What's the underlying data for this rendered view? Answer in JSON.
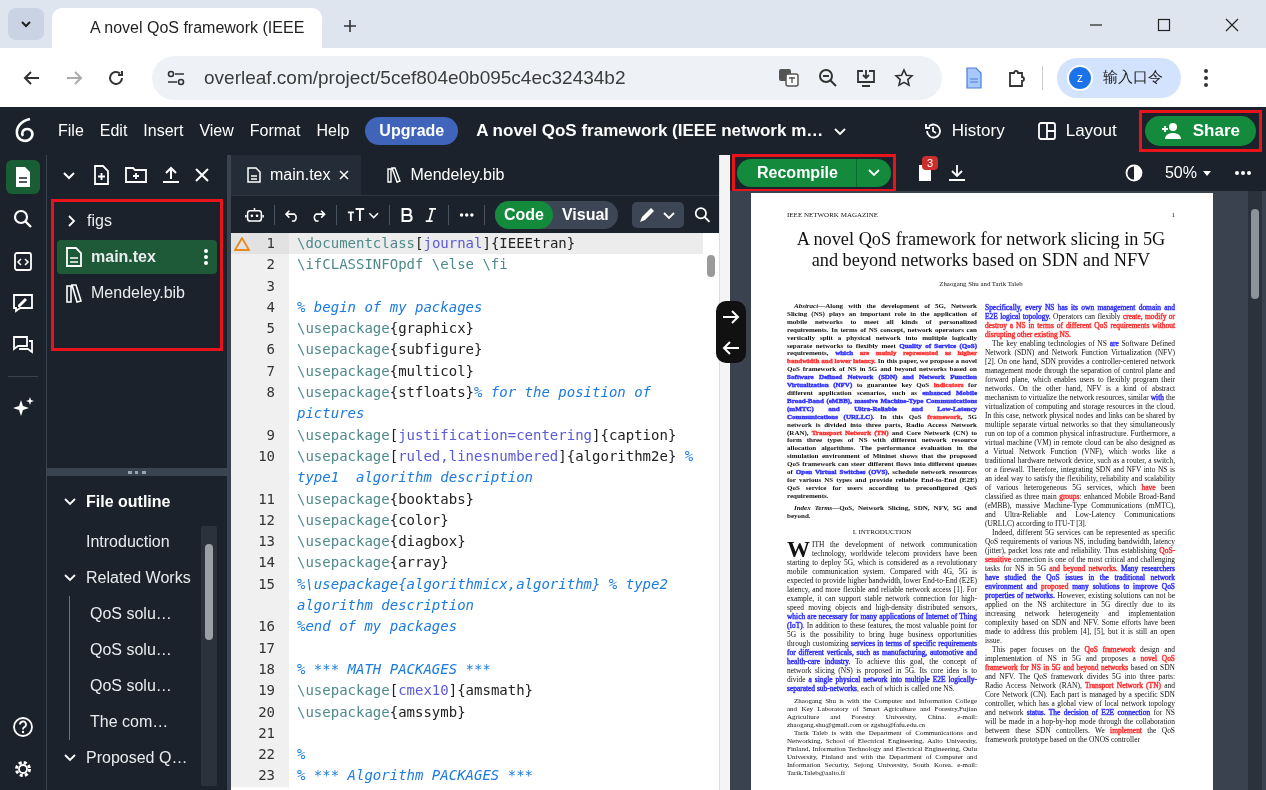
{
  "browser": {
    "tab_title": "A novel QoS framework (IEEE",
    "url": "overleaf.com/project/5cef804e0b095c4ec32434b2",
    "profile_initial": "z",
    "profile_label": "输入口令"
  },
  "menu": [
    "File",
    "Edit",
    "Insert",
    "View",
    "Format",
    "Help"
  ],
  "upgrade": "Upgrade",
  "project_title": "A novel QoS framework (IEEE network m…",
  "history": "History",
  "layout": "Layout",
  "share": "Share",
  "rail": [
    {
      "kind": "files",
      "selected": true
    },
    {
      "kind": "search",
      "selected": false
    },
    {
      "kind": "review",
      "selected": false
    },
    {
      "kind": "preview",
      "selected": false
    },
    {
      "kind": "chat",
      "selected": false
    },
    {
      "kind": "ai",
      "selected": false
    }
  ],
  "file_tree": [
    {
      "name": "figs",
      "kind": "folder",
      "selected": false
    },
    {
      "name": "main.tex",
      "kind": "tex",
      "selected": true
    },
    {
      "name": "Mendeley.bib",
      "kind": "bib",
      "selected": false
    }
  ],
  "outline": {
    "title": "File outline",
    "expanded": true,
    "items": [
      {
        "label": "Introduction"
      },
      {
        "label": "Related Works",
        "expanded": true,
        "children": [
          {
            "label": "QoS solu…"
          },
          {
            "label": "QoS solu…"
          },
          {
            "label": "QoS solu…"
          },
          {
            "label": "The com…"
          }
        ]
      },
      {
        "label": "Proposed Q…",
        "expanded": true
      }
    ]
  },
  "editor_tabs": [
    {
      "label": "main.tex",
      "kind": "tex",
      "selected": true
    },
    {
      "label": "Mendeley.bib",
      "kind": "bib",
      "selected": false
    }
  ],
  "modes": [
    {
      "label": "Code",
      "selected": true
    },
    {
      "label": "Visual",
      "selected": false
    }
  ],
  "code_lines": [
    {
      "n": "1",
      "warning": true,
      "active": true,
      "segs": [
        {
          "kind": "command",
          "t": "\\documentclass"
        },
        {
          "kind": "text",
          "t": "["
        },
        {
          "kind": "option",
          "t": "journal"
        },
        {
          "kind": "text",
          "t": "]{IEEEtran}"
        }
      ]
    },
    {
      "n": "2",
      "warning": false,
      "active": false,
      "segs": [
        {
          "kind": "command",
          "t": "\\ifCLASSINFOpdf \\else \\fi"
        }
      ]
    },
    {
      "n": "3",
      "warning": false,
      "active": false
    },
    {
      "n": "4",
      "warning": false,
      "active": false,
      "segs": [
        {
          "kind": "comment",
          "t": "% begin of my packages"
        }
      ]
    },
    {
      "n": "5",
      "warning": false,
      "active": false,
      "segs": [
        {
          "kind": "command",
          "t": "\\usepackage"
        },
        {
          "kind": "text",
          "t": "{graphicx}"
        }
      ]
    },
    {
      "n": "6",
      "warning": false,
      "active": false,
      "segs": [
        {
          "kind": "command",
          "t": "\\usepackage"
        },
        {
          "kind": "text",
          "t": "{subfigure}"
        }
      ]
    },
    {
      "n": "7",
      "warning": false,
      "active": false,
      "segs": [
        {
          "kind": "command",
          "t": "\\usepackage"
        },
        {
          "kind": "text",
          "t": "{multicol}"
        }
      ]
    },
    {
      "n": "8",
      "warning": false,
      "active": false,
      "segs": [
        {
          "kind": "command",
          "t": "\\usepackage"
        },
        {
          "kind": "text",
          "t": "{stfloats}"
        },
        {
          "kind": "comment",
          "t": "% for the position of pictures"
        }
      ]
    },
    {
      "n": "9",
      "warning": false,
      "active": false,
      "segs": [
        {
          "kind": "command",
          "t": "\\usepackage"
        },
        {
          "kind": "text",
          "t": "["
        },
        {
          "kind": "option",
          "t": "justification=centering"
        },
        {
          "kind": "text",
          "t": "]{caption}"
        }
      ]
    },
    {
      "n": "10",
      "warning": false,
      "active": false,
      "segs": [
        {
          "kind": "command",
          "t": "\\usepackage"
        },
        {
          "kind": "text",
          "t": "["
        },
        {
          "kind": "option",
          "t": "ruled,linesnumbered"
        },
        {
          "kind": "text",
          "t": "]{algorithm2e} "
        },
        {
          "kind": "comment",
          "t": "% type1  algorithm description"
        }
      ]
    },
    {
      "n": "11",
      "warning": false,
      "active": false,
      "segs": [
        {
          "kind": "command",
          "t": "\\usepackage"
        },
        {
          "kind": "text",
          "t": "{booktabs}"
        }
      ]
    },
    {
      "n": "12",
      "warning": false,
      "active": false,
      "segs": [
        {
          "kind": "command",
          "t": "\\usepackage"
        },
        {
          "kind": "text",
          "t": "{color}"
        }
      ]
    },
    {
      "n": "13",
      "warning": false,
      "active": false,
      "segs": [
        {
          "kind": "command",
          "t": "\\usepackage"
        },
        {
          "kind": "text",
          "t": "{diagbox}"
        }
      ]
    },
    {
      "n": "14",
      "warning": false,
      "active": false,
      "segs": [
        {
          "kind": "command",
          "t": "\\usepackage"
        },
        {
          "kind": "text",
          "t": "{array}"
        }
      ]
    },
    {
      "n": "15",
      "warning": false,
      "active": false,
      "segs": [
        {
          "kind": "comment",
          "t": "%\\usepackage{algorithmicx,algorithm} % type2 algorithm description"
        }
      ]
    },
    {
      "n": "16",
      "warning": false,
      "active": false,
      "segs": [
        {
          "kind": "comment",
          "t": "%end of my packages"
        }
      ]
    },
    {
      "n": "17",
      "warning": false,
      "active": false
    },
    {
      "n": "18",
      "warning": false,
      "active": false,
      "segs": [
        {
          "kind": "comment",
          "t": "% *** MATH PACKAGES ***"
        }
      ]
    },
    {
      "n": "19",
      "warning": false,
      "active": false,
      "segs": [
        {
          "kind": "command",
          "t": "\\usepackage"
        },
        {
          "kind": "text",
          "t": "["
        },
        {
          "kind": "option",
          "t": "cmex10"
        },
        {
          "kind": "text",
          "t": "]{amsmath}"
        }
      ]
    },
    {
      "n": "20",
      "warning": false,
      "active": false,
      "segs": [
        {
          "kind": "command",
          "t": "\\usepackage"
        },
        {
          "kind": "text",
          "t": "{amssymb}"
        }
      ]
    },
    {
      "n": "21",
      "warning": false,
      "active": false
    },
    {
      "n": "22",
      "warning": false,
      "active": false,
      "segs": [
        {
          "kind": "comment",
          "t": "%"
        }
      ]
    },
    {
      "n": "23",
      "warning": false,
      "active": false,
      "segs": [
        {
          "kind": "comment",
          "t": "% *** Algorithm PACKAGES ***"
        }
      ]
    }
  ],
  "pdf": {
    "recompile": "Recompile",
    "error_count": "3",
    "zoom": "50%",
    "header": "IEEE NETWORK MAGAZINE",
    "page_number": "1",
    "title": "A novel QoS framework for network slicing in 5G and beyond networks based on SDN and NFV",
    "authors": "Zhaogang Shu and Tarik Taleb",
    "left": [
      {
        "kind": "abstract",
        "segs": [
          {
            "t": "Abstract",
            "italic": true
          },
          {
            "t": "—Along with the development of 5G, Network Slicing (NS) plays an important role in the application of mobile networks to meet all kinds of personalized requirements. In terms of NS concept, network operators can vertically split a physical network into multiple logically separate networks to flexibly meet "
          },
          {
            "t": "Quality of Service (QoS)",
            "color": "#3333ff"
          },
          {
            "t": " requirements, "
          },
          {
            "t": "which",
            "color": "#3333ff"
          },
          {
            "t": " are mainly represented as higher bandwidth and lower latency.",
            "color": "#ff3333"
          },
          {
            "t": " In this paper, we propose a novel QoS framework of NS in 5G and beyond networks based on "
          },
          {
            "t": "Software Defined Network (SDN) and Network Function Virtualization (NFV)",
            "color": "#3333ff"
          },
          {
            "t": " to guarantee key QoS "
          },
          {
            "t": "indicators",
            "color": "#ff3333"
          },
          {
            "t": " for different application scenarios, such as "
          },
          {
            "t": "enhanced Mobile Broad-Band (eMBB), massive Machine-Type Communications (mMTC) and Ultra-Reliable and Low-Latency Communications (URLLC)",
            "color": "#3333ff"
          },
          {
            "t": ". In this QoS "
          },
          {
            "t": "framework",
            "color": "#ff3333"
          },
          {
            "t": ", 5G network is divided into three parts, Radio Access Network (RAN), "
          },
          {
            "t": "Transport Network (TN)",
            "color": "#ff3333"
          },
          {
            "t": " and Core Network (CN) to form three types of NS with different network resource allocation algorithms. The performance evaluation in the simulation environment of Mininet shows that the proposed QoS framework can steer different flows into different queues of "
          },
          {
            "t": "Open Virtual Switches (OVS)",
            "color": "#3333ff"
          },
          {
            "t": ", schedule network resources for various NS types and provide reliable End-to-End (E2E) QoS service for users according to preconfigured QoS requirements."
          }
        ]
      },
      {
        "kind": "abstract",
        "segs": [
          {
            "t": "Index Terms",
            "italic": true
          },
          {
            "t": "—QoS, Network Slicing, SDN, NFV, 5G and beyond."
          }
        ]
      },
      {
        "kind": "heading",
        "segs": [
          {
            "t": "I. INTRODUCTION"
          }
        ]
      },
      {
        "kind": "dropcap",
        "segs": [
          {
            "t": "W",
            "dropcap": true
          },
          {
            "t": "ITH the development of network communication technology, worldwide telecom providers have been starting to deploy 5G, which is considered as a revolutionary mobile communication system. Compared with 4G, 5G is expected to provide higher bandwidth, lower End-to-End (E2E) latency, and more flexible and reliable network access [1]. For example, it can support stable network connection for high-speed moving objects and high-density distributed sensors, "
          },
          {
            "t": "which are necessary for many applications of Internet of Thing (IoT)",
            "color": "#3333ff"
          },
          {
            "t": ". In addition to these features, the most valuable point for 5G is the possibility to bring huge business opportunities through customizing "
          },
          {
            "t": "services in terms of specific requirements for different verticals, such as manufacturing, automotive and health-care industry.",
            "color": "#3333ff"
          },
          {
            "t": " To achieve this goal, the concept of network slicing (NS) is proposed in 5G. Its core idea is to divide "
          },
          {
            "t": "a single physical network into multiple E2E logically-separated sub-networks",
            "color": "#3333ff"
          },
          {
            "t": ", each of which is called one NS."
          }
        ]
      },
      {
        "kind": "footnote",
        "segs": [
          {
            "t": "Zhaogang Shu is with the Computer and Information College and Key Laboratory of Smart Agriculture and Forestry,Fujian Agriculture and Forestry University, China. e-mail: zhaogang.shu@gmail.com or zgshu@fafu.edu.cn"
          }
        ]
      },
      {
        "kind": "footnote",
        "segs": [
          {
            "t": "Tarik Taleb is with the Department of Communications and Networking, School of Electrical Engineering, Aalto University, Finland, Information Technology and Electrical Engineering, Oulu University, Finland and with the Department of Computer and Information Security, Sejong University, South Korea. e-mail: Tarik.Taleb@aalto.fi"
          }
        ]
      }
    ],
    "right": [
      {
        "kind": "continued",
        "segs": [
          {
            "t": "Specifically, every NS has its own management domain and E2E logical topology.",
            "color": "#3333ff"
          },
          {
            "t": " Operators can flexibly "
          },
          {
            "t": "create, modify or destroy a NS in terms of different QoS requirements without disrupting other existing NS.",
            "color": "#ff3333"
          }
        ]
      },
      {
        "kind": "body",
        "segs": [
          {
            "t": "The key enabling technologies of NS "
          },
          {
            "t": "are",
            "color": "#3333ff"
          },
          {
            "t": " Software Defined Network (SDN) and Network Function Virtualization (NFV) [2]. On one hand, SDN provides a controller-centered network management mode through the separation of control plane and forward plane, which enables users to flexibly program their networks. On the other hand, NFV is a kind of abstract mechanism to virtualize the network resources, similar "
          },
          {
            "t": "with",
            "color": "#3333ff"
          },
          {
            "t": " the virtualization of computing and storage resources in the cloud. In this case, network physical nodes and links can be shared by multiple separate virtual networks so that they simultaneously run on top of a common physical infrastructure. Furthermore, a virtual machine (VM) in remote cloud can be also designed as a Virtual Network Function (VNF), which works like a traditional hardware network device, such as a router, a switch, or a firewall. Therefore, integrating SDN and NFV into NS is an ideal way to satisfy the flexibility, reliability and scalability of various heterogeneous 5G services, which "
          },
          {
            "t": "have",
            "color": "#ff3333"
          },
          {
            "t": " been classified as three main "
          },
          {
            "t": "groups",
            "color": "#ff3333"
          },
          {
            "t": ": enhanced Mobile Broad-Band (eMBB), massive Machine-Type Communications (mMTC), and Ultra-Reliable and Low-Latency Communications (URLLC) according to ITU-T [3]."
          }
        ]
      },
      {
        "kind": "body",
        "segs": [
          {
            "t": "Indeed, different 5G services can be represented as specific QoS requirements of various NS, including bandwidth, latency (jitter), packet loss rate and reliability. Thus establishing "
          },
          {
            "t": "QoS-sensitive",
            "color": "#ff3333"
          },
          {
            "t": " connection is one of the most critical and challenging tasks for NS in 5G "
          },
          {
            "t": "and beyond networks. ",
            "color": "#ff3333"
          },
          {
            "t": "Many researchers have studied the QoS issues in the traditional network environment and ",
            "color": "#3333ff"
          },
          {
            "t": "proposed",
            "color": "#ff3333"
          },
          {
            "t": " many solutions to improve QoS properties of networks.",
            "color": "#3333ff"
          },
          {
            "t": " However, existing solutions can not be applied on the NS architecture in 5G directly due to its increasing network heterogeneity and implementation complexity based on SDN and NFV. Some efforts have been made to address this problem [4], [5], but it is still an open issue."
          }
        ]
      },
      {
        "kind": "body",
        "segs": [
          {
            "t": "This paper focuses on the "
          },
          {
            "t": "QoS framework",
            "color": "#ff3333"
          },
          {
            "t": " design and implementation of NS in 5G and proposes a "
          },
          {
            "t": "novel QoS framework for NS in 5G and beyond networks",
            "color": "#ff3333"
          },
          {
            "t": " based on SDN and NFV. The QoS framework divides 5G into three parts: Radio Access Network (RAN), "
          },
          {
            "t": "Transport Network (TN)",
            "color": "#ff3333"
          },
          {
            "t": " and Core Network (CN). Each part is managed by a specific SDN controller, which has a global view of local network topology and network "
          },
          {
            "t": "status. The decision of E2E connection",
            "color": "#3333ff"
          },
          {
            "t": " for NS will be made in a hop-by-hop mode through the collaboration between these SDN controllers. We "
          },
          {
            "t": "implement",
            "color": "#ff3333"
          },
          {
            "t": " the QoS framework prototype based on the ONOS controller"
          }
        ]
      }
    ]
  }
}
